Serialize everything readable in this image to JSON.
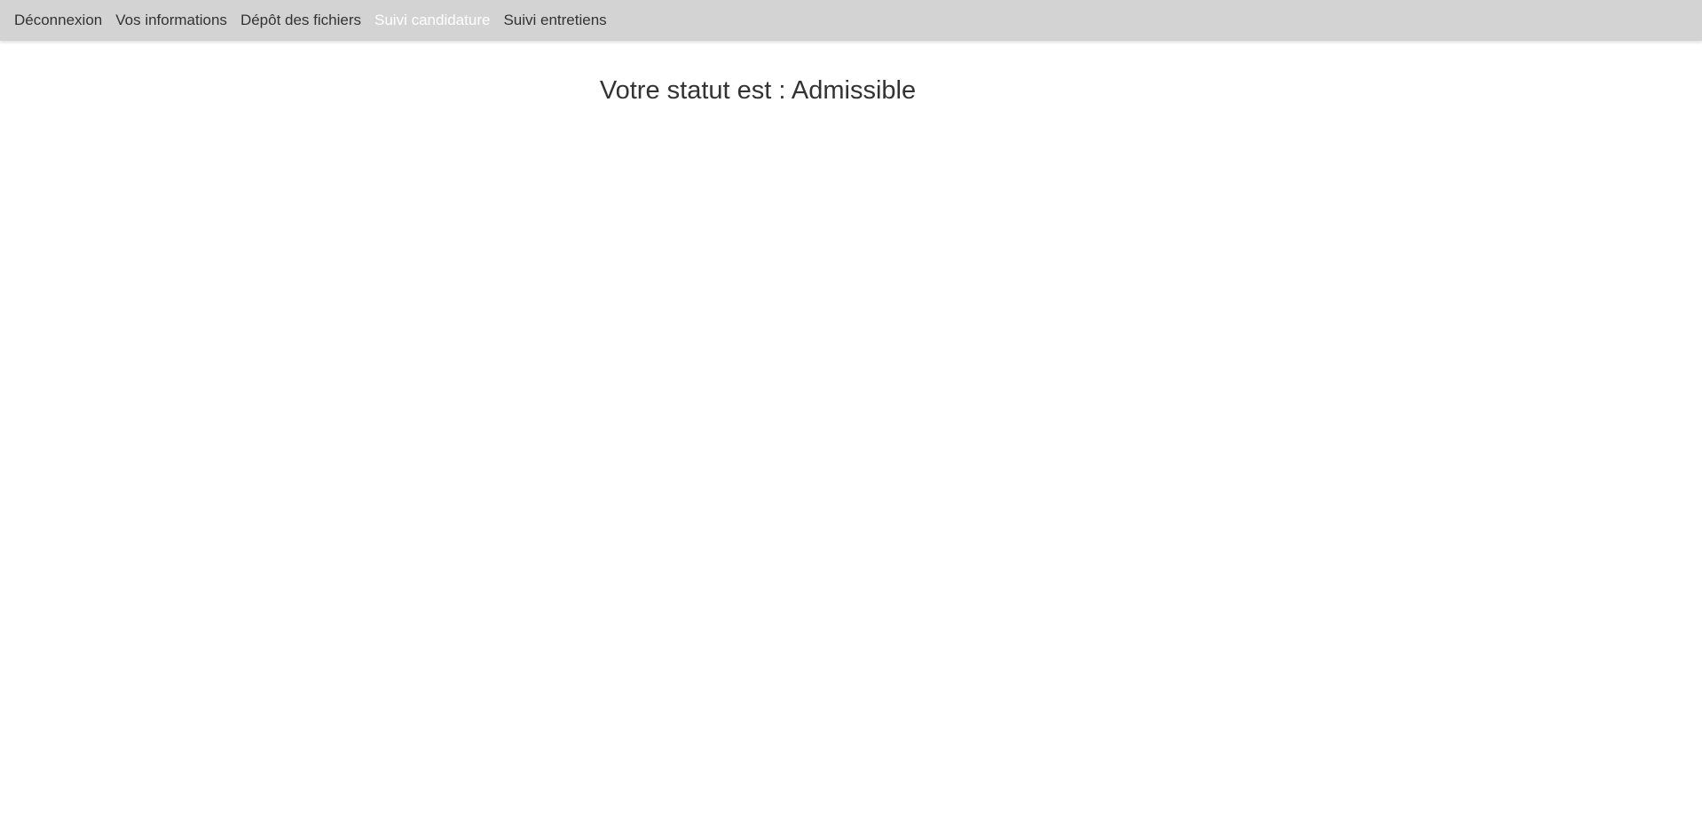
{
  "nav": {
    "items": [
      {
        "label": "Déconnexion",
        "active": false
      },
      {
        "label": "Vos informations",
        "active": false
      },
      {
        "label": "Dépôt des fichiers",
        "active": false
      },
      {
        "label": "Suivi candidature",
        "active": true
      },
      {
        "label": "Suivi entretiens",
        "active": false
      }
    ]
  },
  "main": {
    "status_text": "Votre statut est : Admissible"
  },
  "colors": {
    "navbar_bg": "#d3d3d3",
    "nav_text": "#333333",
    "nav_active_text": "#ffffff",
    "page_bg": "#ffffff"
  }
}
